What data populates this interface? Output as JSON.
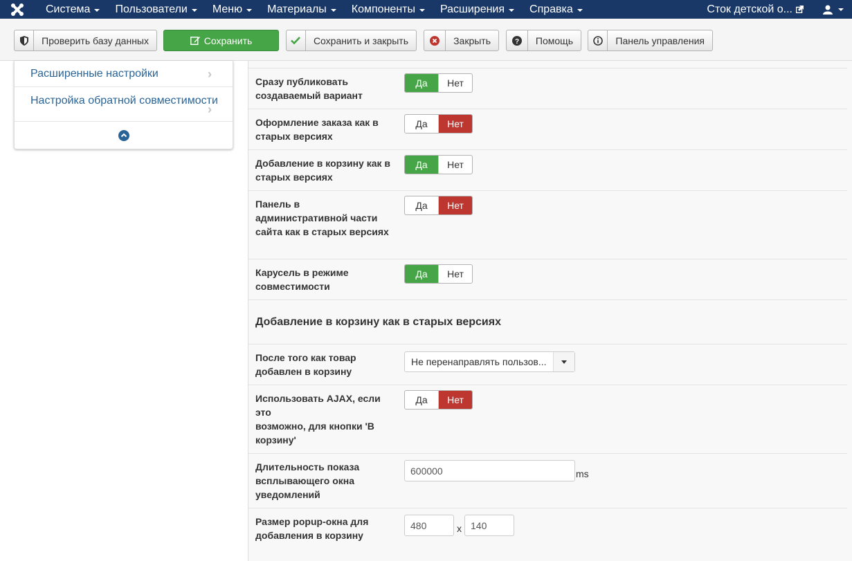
{
  "navbar": {
    "logo_icon": "joomla-logo-icon",
    "menu": [
      "Система",
      "Пользователи",
      "Меню",
      "Материалы",
      "Компоненты",
      "Расширения",
      "Справка"
    ],
    "site_name": "Сток детской о...",
    "user_icon": "user-icon"
  },
  "toolbar": {
    "check_db": "Проверить базу данных",
    "save": "Сохранить",
    "save_close": "Сохранить и закрыть",
    "close": "Закрыть",
    "help": "Помощь",
    "control_panel": "Панель управления"
  },
  "sidebar": {
    "items": [
      "Расширенные настройки",
      "Настройка обратной совместимости"
    ]
  },
  "settings": [
    {
      "label": "Сразу публиковать создаваемый вариант",
      "yes": "Да",
      "no": "Нет",
      "value": "yes"
    },
    {
      "label": "Оформление заказа как в старых версиях",
      "yes": "Да",
      "no": "Нет",
      "value": "no"
    },
    {
      "label": "Добавление в корзину как в старых версиях",
      "yes": "Да",
      "no": "Нет",
      "value": "yes"
    },
    {
      "label": "Панель в административной части сайта как в старых версиях",
      "yes": "Да",
      "no": "Нет",
      "value": "no"
    },
    {
      "label": "Карусель в режиме совместимости",
      "yes": "Да",
      "no": "Нет",
      "value": "yes"
    }
  ],
  "section2": {
    "title": "Добавление в корзину как в старых версиях",
    "redirect_label": "После того как товар добавлен в корзину",
    "redirect_value": "Не перенаправлять пользов...",
    "ajax_label_1": "Использовать AJAX, если это",
    "ajax_label_2": "возможно, для кнопки 'В корзину'",
    "ajax_yes": "Да",
    "ajax_no": "Нет",
    "ajax_value": "no",
    "duration_label": "Длительность показа всплывающего окна уведомлений",
    "duration_value": "600000",
    "duration_unit": "ms",
    "popup_label": "Размер popup-окна для добавления в корзину",
    "popup_width": "480",
    "popup_sep": "x",
    "popup_height": "140"
  },
  "colors": {
    "navbar": "#1a3867",
    "success": "#46a546",
    "danger": "#bd362f",
    "link": "#2a6496"
  }
}
